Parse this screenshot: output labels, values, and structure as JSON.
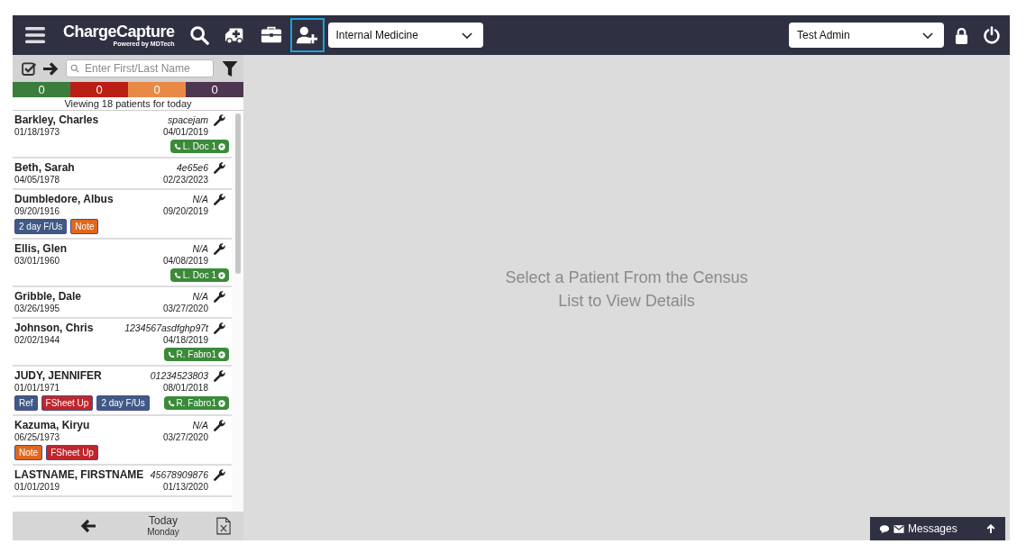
{
  "header": {
    "logo_title": "ChargeCapture",
    "logo_subtitle": "Powered by MDTech",
    "tools": [
      {
        "kind": "search",
        "selected": false
      },
      {
        "kind": "ambulance",
        "selected": false
      },
      {
        "kind": "briefcase",
        "selected": false
      },
      {
        "kind": "add-user",
        "selected": true
      }
    ],
    "department": "Internal Medicine",
    "user": "Test Admin"
  },
  "sidebar": {
    "search": {
      "placeholder": "Enter First/Last Name"
    },
    "counts": [
      {
        "value": "0",
        "color": "#3b7d3a"
      },
      {
        "value": "0",
        "color": "#bb1e14"
      },
      {
        "value": "0",
        "color": "#e88a45"
      },
      {
        "value": "0",
        "color": "#4e3550"
      }
    ],
    "summary": "Viewing 18 patients for today",
    "patients": [
      {
        "name": "Barkley, Charles",
        "dob": "01/18/1973",
        "id": "spacejam",
        "date": "04/01/2019",
        "provider": "L. Doc 1"
      },
      {
        "name": "Beth, Sarah",
        "dob": "04/05/1978",
        "id": "4e65e6",
        "date": "02/23/2023"
      },
      {
        "name": "Dumbledore, Albus",
        "dob": "09/20/1916",
        "id": "N/A",
        "date": "09/20/2019",
        "tags": [
          {
            "label": "2 day F/Us",
            "color": "#3f5a85"
          },
          {
            "label": "Note",
            "color": "#e0681e"
          }
        ]
      },
      {
        "name": "Ellis, Glen",
        "dob": "03/01/1960",
        "id": "N/A",
        "date": "04/08/2019",
        "provider": "L. Doc 1"
      },
      {
        "name": "Gribble, Dale",
        "dob": "03/26/1995",
        "id": "N/A",
        "date": "03/27/2020"
      },
      {
        "name": "Johnson, Chris",
        "dob": "02/02/1944",
        "id": "1234567asdfghp97t",
        "date": "04/18/2019",
        "provider": "R. Fabro1"
      },
      {
        "name": "JUDY, JENNIFER",
        "dob": "01/01/1971",
        "id": "01234523803",
        "date": "08/01/2018",
        "provider": "R. Fabro1",
        "tags": [
          {
            "label": "Ref",
            "color": "#3f5a85"
          },
          {
            "label": "FSheet Up",
            "color": "#c0262c"
          },
          {
            "label": "2 day F/Us",
            "color": "#3f5a85"
          }
        ]
      },
      {
        "name": "Kazuma, Kiryu",
        "dob": "06/25/1973",
        "id": "N/A",
        "date": "03/27/2020",
        "tags": [
          {
            "label": "Note",
            "color": "#e0681e"
          },
          {
            "label": "FSheet Up",
            "color": "#c0262c"
          }
        ]
      },
      {
        "name": "LASTNAME, FIRSTNAME",
        "dob": "01/01/2019",
        "id": "45678909876",
        "date": "01/13/2020"
      }
    ],
    "footer": {
      "day": "Today",
      "weekday": "Monday"
    }
  },
  "main": {
    "message": "Select a Patient From the Census List to View Details"
  },
  "messages": {
    "label": "Messages"
  }
}
